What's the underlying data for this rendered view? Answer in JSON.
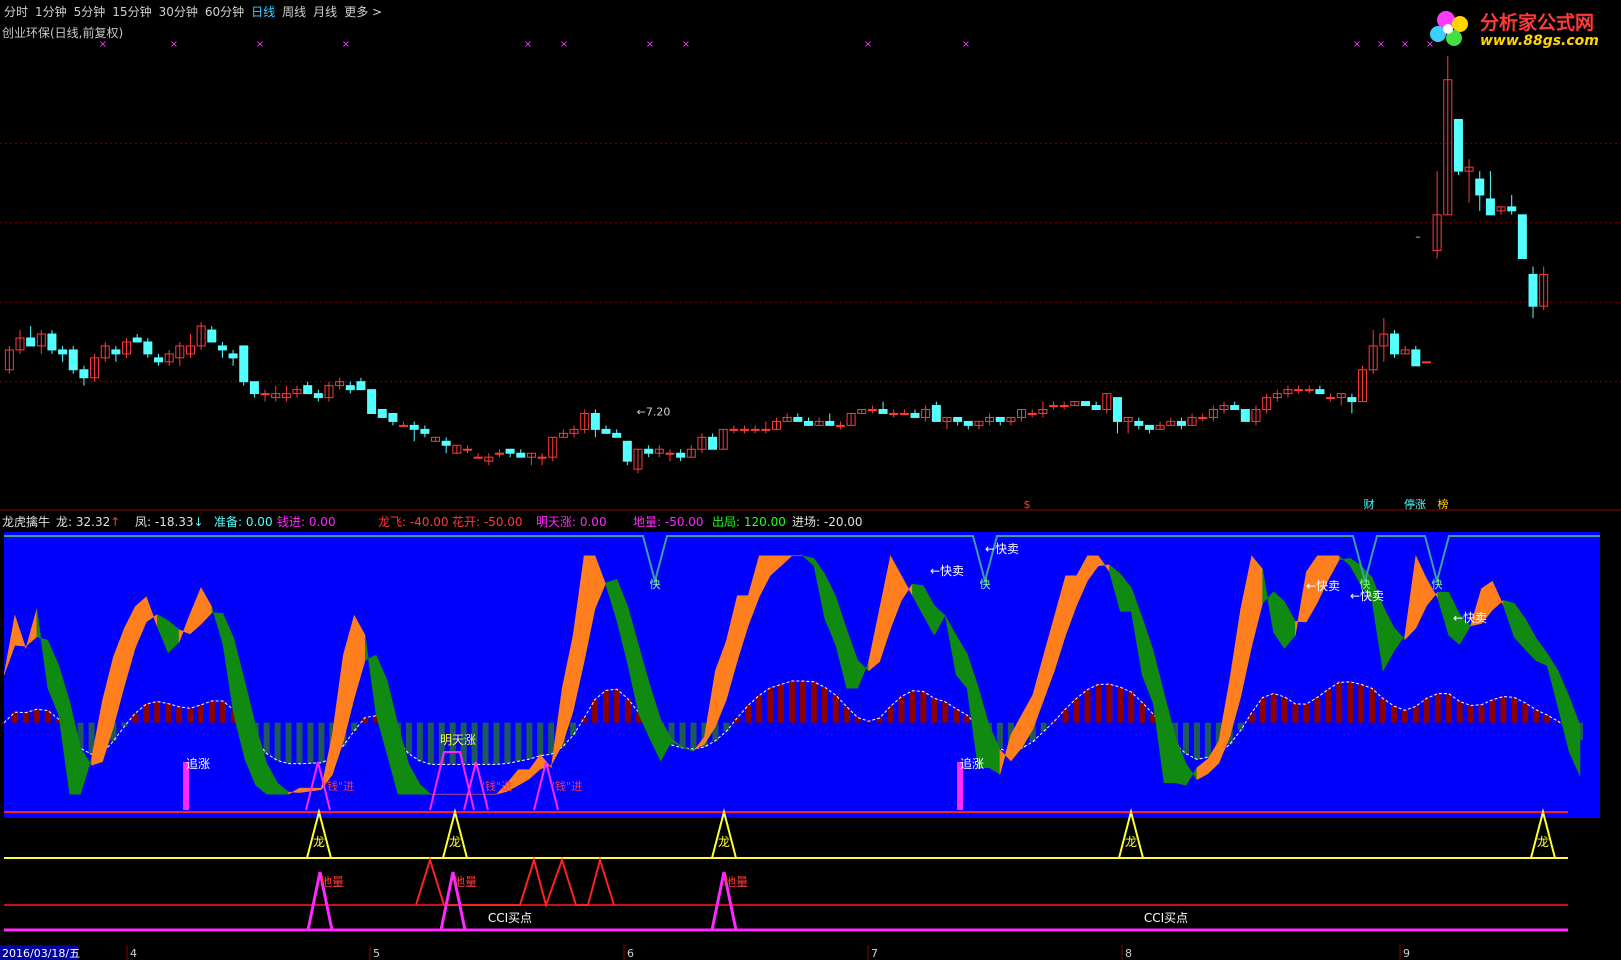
{
  "toolbar": {
    "items": [
      "分时",
      "1分钟",
      "5分钟",
      "15分钟",
      "30分钟",
      "60分钟",
      "日线",
      "周线",
      "月线",
      "更多 >"
    ],
    "active": "日线"
  },
  "stock_title": "创业环保(日线,前复权)",
  "logo": {
    "name": "分析家公式网",
    "url_text": "www.88gs.com"
  },
  "colors": {
    "up": "#ff3a3a",
    "down": "#54ffff",
    "grid": "#8a0000",
    "panel_bg": "#0000ff",
    "orange": "#ff7f1e",
    "green": "#118a11",
    "magenta": "#ff28ff",
    "yellow": "#ffff33",
    "red_line": "#ff1e1e"
  },
  "price_panel": {
    "low_label": "←7.20",
    "top_markers_label": "×",
    "right_labels": [
      {
        "text": "财",
        "color": "#54ffff"
      },
      {
        "text": "停涨",
        "color": "#54ffff"
      },
      {
        "text": "榜",
        "color": "#ffd400"
      }
    ],
    "mid_marker": "$",
    "peak_dash": "–"
  },
  "indicator": {
    "name": "龙虎擒牛",
    "fields": [
      {
        "label": "龙: ",
        "value": "32.32",
        "arrow": "↑",
        "color": "#e0e0e0",
        "arrow_color": "#ff3a3a"
      },
      {
        "label": "凤: ",
        "value": "-18.33",
        "arrow": "↓",
        "color": "#e0e0e0",
        "arrow_color": "#54ffff"
      },
      {
        "label": "准备: ",
        "value": "0.00",
        "color": "#54ffff"
      },
      {
        "label": "钱进: ",
        "value": "0.00",
        "color": "#ff28ff"
      },
      {
        "label": "龙飞: ",
        "value": "-40.00",
        "color": "#ff3a3a"
      },
      {
        "label": "花开: ",
        "value": "-50.00",
        "color": "#ff3a3a"
      },
      {
        "label": "明天涨: ",
        "value": "0.00",
        "color": "#ff28ff"
      },
      {
        "label": "地量: ",
        "value": "-50.00",
        "color": "#ff28ff"
      },
      {
        "label": "出局: ",
        "value": "120.00",
        "color": "#22ff22"
      },
      {
        "label": "进场: ",
        "value": "-20.00",
        "color": "#e0e0e0"
      }
    ],
    "annotations": {
      "zhuizhang": "追涨",
      "qianjin": "\"钱\"进",
      "mingtianzhang": "明天涨",
      "kuaimai": "←快卖",
      "kuai": "快",
      "long": "龙",
      "diliang": "地量",
      "cci": "CCI买点"
    }
  },
  "date_axis": {
    "first": "2016/03/18/五",
    "months": [
      "4",
      "5",
      "6",
      "7",
      "8",
      "9"
    ]
  },
  "chart_data": {
    "type": "candlestick",
    "note_low": 7.2,
    "candles": [
      [
        8.3,
        8.9,
        8.2,
        8.8
      ],
      [
        8.8,
        9.3,
        8.7,
        9.1
      ],
      [
        9.1,
        9.4,
        8.9,
        8.9
      ],
      [
        8.9,
        9.3,
        8.7,
        9.2
      ],
      [
        9.2,
        9.3,
        8.7,
        8.8
      ],
      [
        8.8,
        8.9,
        8.5,
        8.7
      ],
      [
        8.8,
        8.9,
        8.2,
        8.3
      ],
      [
        8.3,
        8.4,
        7.9,
        8.1
      ],
      [
        8.1,
        8.7,
        8.0,
        8.6
      ],
      [
        8.6,
        9.0,
        8.5,
        8.9
      ],
      [
        8.8,
        8.9,
        8.5,
        8.7
      ],
      [
        8.7,
        9.1,
        8.6,
        9.0
      ],
      [
        9.1,
        9.2,
        9.0,
        9.0
      ],
      [
        9.0,
        9.1,
        8.6,
        8.7
      ],
      [
        8.6,
        8.7,
        8.4,
        8.5
      ],
      [
        8.5,
        8.8,
        8.4,
        8.7
      ],
      [
        8.6,
        9.0,
        8.4,
        8.9
      ],
      [
        8.7,
        9.2,
        8.6,
        8.9
      ],
      [
        8.9,
        9.5,
        8.8,
        9.4
      ],
      [
        9.3,
        9.4,
        9.0,
        9.0
      ],
      [
        8.9,
        9.0,
        8.6,
        8.8
      ],
      [
        8.7,
        8.8,
        8.4,
        8.6
      ],
      [
        8.9,
        8.9,
        7.9,
        8.0
      ],
      [
        8.0,
        8.0,
        7.6,
        7.7
      ],
      [
        7.7,
        7.8,
        7.5,
        7.7
      ],
      [
        7.6,
        7.9,
        7.5,
        7.7
      ],
      [
        7.6,
        7.9,
        7.5,
        7.7
      ],
      [
        7.7,
        7.9,
        7.6,
        7.8
      ],
      [
        7.9,
        8.0,
        7.7,
        7.7
      ],
      [
        7.7,
        7.8,
        7.5,
        7.6
      ],
      [
        7.6,
        8.0,
        7.5,
        7.9
      ],
      [
        7.9,
        8.1,
        7.8,
        8.0
      ],
      [
        7.9,
        8.0,
        7.7,
        7.8
      ],
      [
        8.0,
        8.1,
        7.8,
        7.8
      ],
      [
        7.8,
        7.8,
        7.4,
        7.2
      ],
      [
        7.3,
        7.3,
        7.1,
        7.1
      ],
      [
        7.2,
        7.2,
        6.9,
        7.0
      ],
      [
        6.9,
        7.0,
        6.9,
        6.9
      ],
      [
        6.9,
        7.0,
        6.5,
        6.8
      ],
      [
        6.8,
        6.9,
        6.6,
        6.7
      ],
      [
        6.5,
        6.6,
        6.5,
        6.6
      ],
      [
        6.5,
        6.6,
        6.2,
        6.4
      ],
      [
        6.2,
        6.4,
        6.2,
        6.4
      ],
      [
        6.3,
        6.4,
        6.2,
        6.3
      ],
      [
        6.1,
        6.2,
        6.1,
        6.1
      ],
      [
        6.0,
        6.2,
        5.9,
        6.1
      ],
      [
        6.2,
        6.3,
        6.1,
        6.2
      ],
      [
        6.3,
        6.3,
        6.1,
        6.2
      ],
      [
        6.2,
        6.3,
        6.1,
        6.1
      ],
      [
        6.1,
        6.2,
        5.9,
        6.2
      ],
      [
        6.1,
        6.2,
        5.9,
        6.1
      ],
      [
        6.1,
        6.6,
        6.0,
        6.6
      ],
      [
        6.6,
        6.8,
        6.6,
        6.7
      ],
      [
        6.7,
        6.9,
        6.6,
        6.8
      ],
      [
        6.8,
        7.3,
        6.7,
        7.2
      ],
      [
        7.2,
        7.3,
        6.6,
        6.8
      ],
      [
        6.8,
        6.9,
        6.7,
        6.7
      ],
      [
        6.7,
        6.8,
        6.6,
        6.6
      ],
      [
        6.5,
        6.5,
        5.9,
        6.0
      ],
      [
        5.8,
        6.3,
        5.7,
        6.3
      ],
      [
        6.3,
        6.4,
        6.1,
        6.2
      ],
      [
        6.2,
        6.4,
        6.1,
        6.3
      ],
      [
        6.2,
        6.3,
        6.0,
        6.2
      ],
      [
        6.2,
        6.3,
        6.0,
        6.1
      ],
      [
        6.1,
        6.4,
        6.1,
        6.3
      ],
      [
        6.3,
        6.7,
        6.2,
        6.6
      ],
      [
        6.6,
        6.7,
        6.3,
        6.3
      ],
      [
        6.3,
        6.8,
        6.3,
        6.8
      ],
      [
        6.8,
        6.9,
        6.7,
        6.8
      ],
      [
        6.8,
        6.9,
        6.7,
        6.8
      ],
      [
        6.8,
        6.9,
        6.7,
        6.8
      ],
      [
        6.8,
        7.0,
        6.7,
        6.8
      ],
      [
        6.8,
        7.1,
        6.8,
        7.0
      ],
      [
        7.0,
        7.2,
        7.0,
        7.1
      ],
      [
        7.1,
        7.2,
        7.0,
        7.0
      ],
      [
        7.0,
        7.1,
        6.9,
        6.9
      ],
      [
        6.9,
        7.1,
        6.9,
        7.0
      ],
      [
        7.0,
        7.2,
        6.9,
        6.9
      ],
      [
        6.9,
        7.0,
        6.8,
        6.9
      ],
      [
        6.9,
        7.2,
        6.9,
        7.2
      ],
      [
        7.2,
        7.3,
        7.2,
        7.3
      ],
      [
        7.3,
        7.4,
        7.2,
        7.3
      ],
      [
        7.3,
        7.5,
        7.2,
        7.2
      ],
      [
        7.2,
        7.3,
        7.1,
        7.2
      ],
      [
        7.2,
        7.3,
        7.2,
        7.2
      ],
      [
        7.2,
        7.3,
        7.1,
        7.1
      ],
      [
        7.1,
        7.4,
        7.0,
        7.3
      ],
      [
        7.4,
        7.5,
        7.0,
        7.0
      ],
      [
        7.0,
        7.1,
        6.8,
        7.1
      ],
      [
        7.1,
        7.1,
        6.9,
        7.0
      ],
      [
        7.0,
        7.0,
        6.8,
        6.9
      ],
      [
        6.9,
        7.0,
        6.8,
        7.0
      ],
      [
        7.0,
        7.2,
        6.9,
        7.1
      ],
      [
        7.1,
        7.1,
        6.9,
        7.0
      ],
      [
        7.0,
        7.1,
        6.9,
        7.1
      ],
      [
        7.1,
        7.3,
        7.0,
        7.3
      ],
      [
        7.2,
        7.3,
        7.1,
        7.2
      ],
      [
        7.2,
        7.5,
        7.1,
        7.3
      ],
      [
        7.4,
        7.5,
        7.3,
        7.4
      ],
      [
        7.4,
        7.5,
        7.3,
        7.4
      ],
      [
        7.4,
        7.5,
        7.4,
        7.5
      ],
      [
        7.5,
        7.5,
        7.4,
        7.4
      ],
      [
        7.4,
        7.5,
        7.3,
        7.3
      ],
      [
        7.3,
        7.7,
        7.2,
        7.7
      ],
      [
        7.6,
        7.6,
        6.7,
        7.0
      ],
      [
        7.0,
        7.1,
        6.7,
        7.1
      ],
      [
        7.0,
        7.1,
        6.8,
        6.9
      ],
      [
        6.9,
        6.9,
        6.7,
        6.8
      ],
      [
        6.8,
        7.0,
        6.8,
        6.9
      ],
      [
        6.9,
        7.1,
        6.9,
        7.0
      ],
      [
        7.0,
        7.1,
        6.8,
        6.9
      ],
      [
        6.9,
        7.2,
        6.9,
        7.1
      ],
      [
        7.1,
        7.2,
        7.0,
        7.1
      ],
      [
        7.1,
        7.4,
        7.0,
        7.3
      ],
      [
        7.3,
        7.5,
        7.2,
        7.4
      ],
      [
        7.4,
        7.5,
        7.3,
        7.3
      ],
      [
        7.3,
        7.3,
        7.2,
        7.0
      ],
      [
        7.0,
        7.4,
        6.9,
        7.3
      ],
      [
        7.3,
        7.7,
        7.2,
        7.6
      ],
      [
        7.6,
        7.8,
        7.5,
        7.7
      ],
      [
        7.7,
        7.9,
        7.6,
        7.8
      ],
      [
        7.8,
        7.9,
        7.7,
        7.8
      ],
      [
        7.8,
        7.9,
        7.7,
        7.8
      ],
      [
        7.8,
        7.9,
        7.7,
        7.7
      ],
      [
        7.6,
        7.7,
        7.5,
        7.6
      ],
      [
        7.6,
        7.7,
        7.4,
        7.7
      ],
      [
        7.6,
        7.7,
        7.2,
        7.5
      ],
      [
        7.5,
        8.4,
        7.5,
        8.3
      ],
      [
        8.3,
        9.3,
        8.2,
        8.9
      ],
      [
        8.9,
        9.6,
        8.5,
        9.2
      ],
      [
        9.2,
        9.3,
        8.6,
        8.7
      ],
      [
        8.7,
        8.9,
        8.7,
        8.8
      ],
      [
        8.8,
        8.9,
        8.4,
        8.4
      ],
      [
        8.5,
        8.5,
        8.5,
        8.5
      ],
      [
        11.3,
        13.3,
        11.1,
        12.2
      ],
      [
        12.2,
        16.2,
        12.2,
        15.6
      ],
      [
        14.6,
        14.6,
        13.2,
        13.3
      ],
      [
        13.3,
        13.6,
        12.5,
        13.4
      ],
      [
        13.1,
        13.3,
        12.3,
        12.7
      ],
      [
        12.6,
        13.3,
        12.5,
        12.2
      ],
      [
        12.3,
        12.4,
        12.2,
        12.4
      ],
      [
        12.4,
        12.7,
        12.2,
        12.3
      ],
      [
        12.2,
        12.2,
        11.1,
        11.1
      ],
      [
        10.7,
        10.9,
        9.6,
        9.9
      ],
      [
        9.9,
        10.9,
        9.8,
        10.7
      ]
    ],
    "indicator_panel": {
      "lines": [
        "long",
        "feng",
        "chuju",
        "jinchang"
      ],
      "ranges": {
        "y": [
          -100,
          150
        ]
      }
    }
  }
}
